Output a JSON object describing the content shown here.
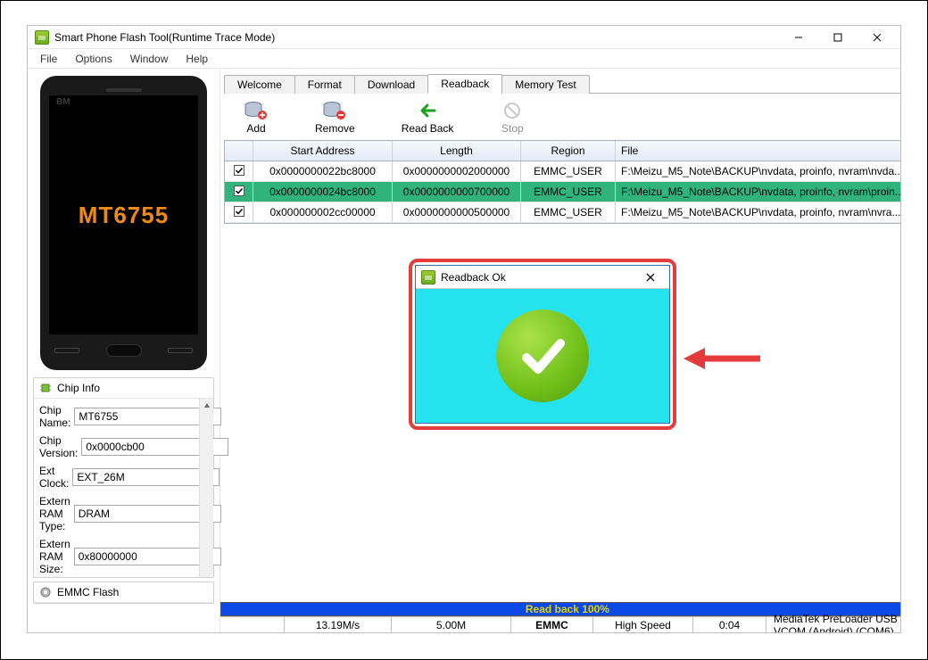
{
  "window": {
    "title": "Smart Phone Flash Tool(Runtime Trace Mode)"
  },
  "menu": {
    "file": "File",
    "options": "Options",
    "window": "Window",
    "help": "Help"
  },
  "phone": {
    "chip_label": "MT6755",
    "bm": "BM"
  },
  "chip_info": {
    "group_title": "Chip Info",
    "rows": {
      "name_label": "Chip Name:",
      "name_value": "MT6755",
      "ver_label": "Chip Version:",
      "ver_value": "0x0000cb00",
      "clk_label": "Ext Clock:",
      "clk_value": "EXT_26M",
      "ramtype_label": "Extern RAM Type:",
      "ramtype_value": "DRAM",
      "ramsize_label": "Extern RAM Size:",
      "ramsize_value": "0x80000000"
    }
  },
  "emmc": {
    "group_title": "EMMC Flash"
  },
  "tabs": {
    "welcome": "Welcome",
    "format": "Format",
    "download": "Download",
    "readback": "Readback",
    "memtest": "Memory Test"
  },
  "toolbar": {
    "add": "Add",
    "remove": "Remove",
    "readback": "Read Back",
    "stop": "Stop"
  },
  "table": {
    "headers": {
      "start": "Start Address",
      "length": "Length",
      "region": "Region",
      "file": "File"
    },
    "rows": [
      {
        "start": "0x0000000022bc8000",
        "length": "0x0000000002000000",
        "region": "EMMC_USER",
        "file": "F:\\Meizu_M5_Note\\BACKUP\\nvdata, proinfo, nvram\\nvda...",
        "selected": false
      },
      {
        "start": "0x0000000024bc8000",
        "length": "0x0000000000700000",
        "region": "EMMC_USER",
        "file": "F:\\Meizu_M5_Note\\BACKUP\\nvdata, proinfo, nvram\\proin...",
        "selected": true
      },
      {
        "start": "0x000000002cc00000",
        "length": "0x0000000000500000",
        "region": "EMMC_USER",
        "file": "F:\\Meizu_M5_Note\\BACKUP\\nvdata, proinfo, nvram\\nvra...",
        "selected": false
      }
    ]
  },
  "progress": {
    "text": "Read back 100%"
  },
  "status": {
    "speed": "13.19M/s",
    "size": "5.00M",
    "storage": "EMMC",
    "mode": "High Speed",
    "time": "0:04",
    "port": "MediaTek PreLoader USB VCOM (Android) (COM6)"
  },
  "dialog": {
    "title": "Readback Ok"
  }
}
